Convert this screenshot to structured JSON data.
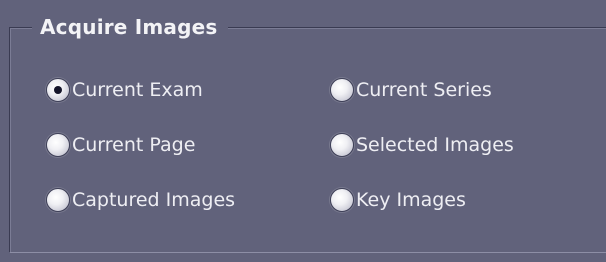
{
  "group": {
    "title": "Acquire Images"
  },
  "options": [
    {
      "label": "Current Exam",
      "checked": true
    },
    {
      "label": "Current Series",
      "checked": false
    },
    {
      "label": "Current Page",
      "checked": false
    },
    {
      "label": "Selected Images",
      "checked": false
    },
    {
      "label": "Captured Images",
      "checked": false
    },
    {
      "label": "Key Images",
      "checked": false
    }
  ]
}
